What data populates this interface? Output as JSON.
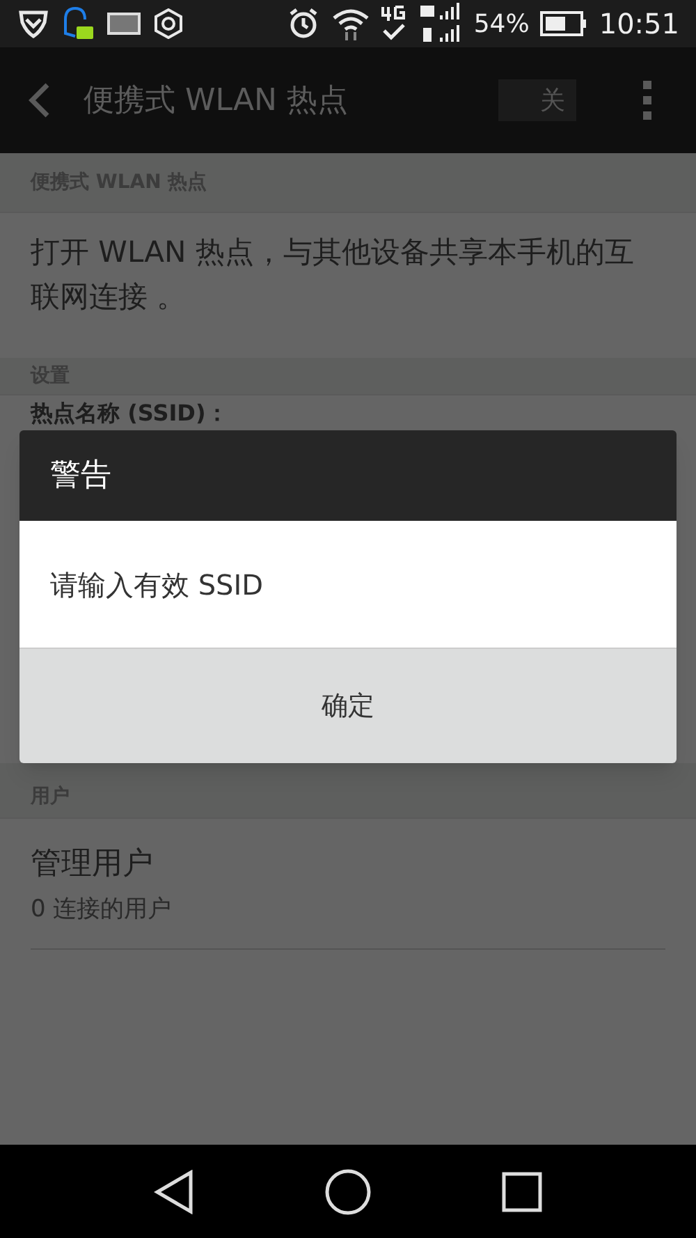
{
  "status_bar": {
    "battery": "54%",
    "time": "10:51"
  },
  "app_bar": {
    "title": "便携式 WLAN 热点",
    "switch": {
      "label": "关",
      "on": false
    }
  },
  "sections": [
    {
      "header": "便携式 WLAN 热点",
      "items": [
        {
          "kind": "text",
          "text": "打开 WLAN 热点，与其他设备共享本手机的互联网连接 。"
        }
      ]
    },
    {
      "header": "设置",
      "items": [
        {
          "kind": "label",
          "text": "热点名称 (SSID)："
        }
      ]
    },
    {
      "header": "用户",
      "items": [
        {
          "kind": "entry",
          "title": "管理用户",
          "subtitle": "0 连接的用户"
        }
      ]
    }
  ],
  "dialog": {
    "title": "警告",
    "message": "请输入有效 SSID",
    "buttons": [
      "确定"
    ]
  }
}
